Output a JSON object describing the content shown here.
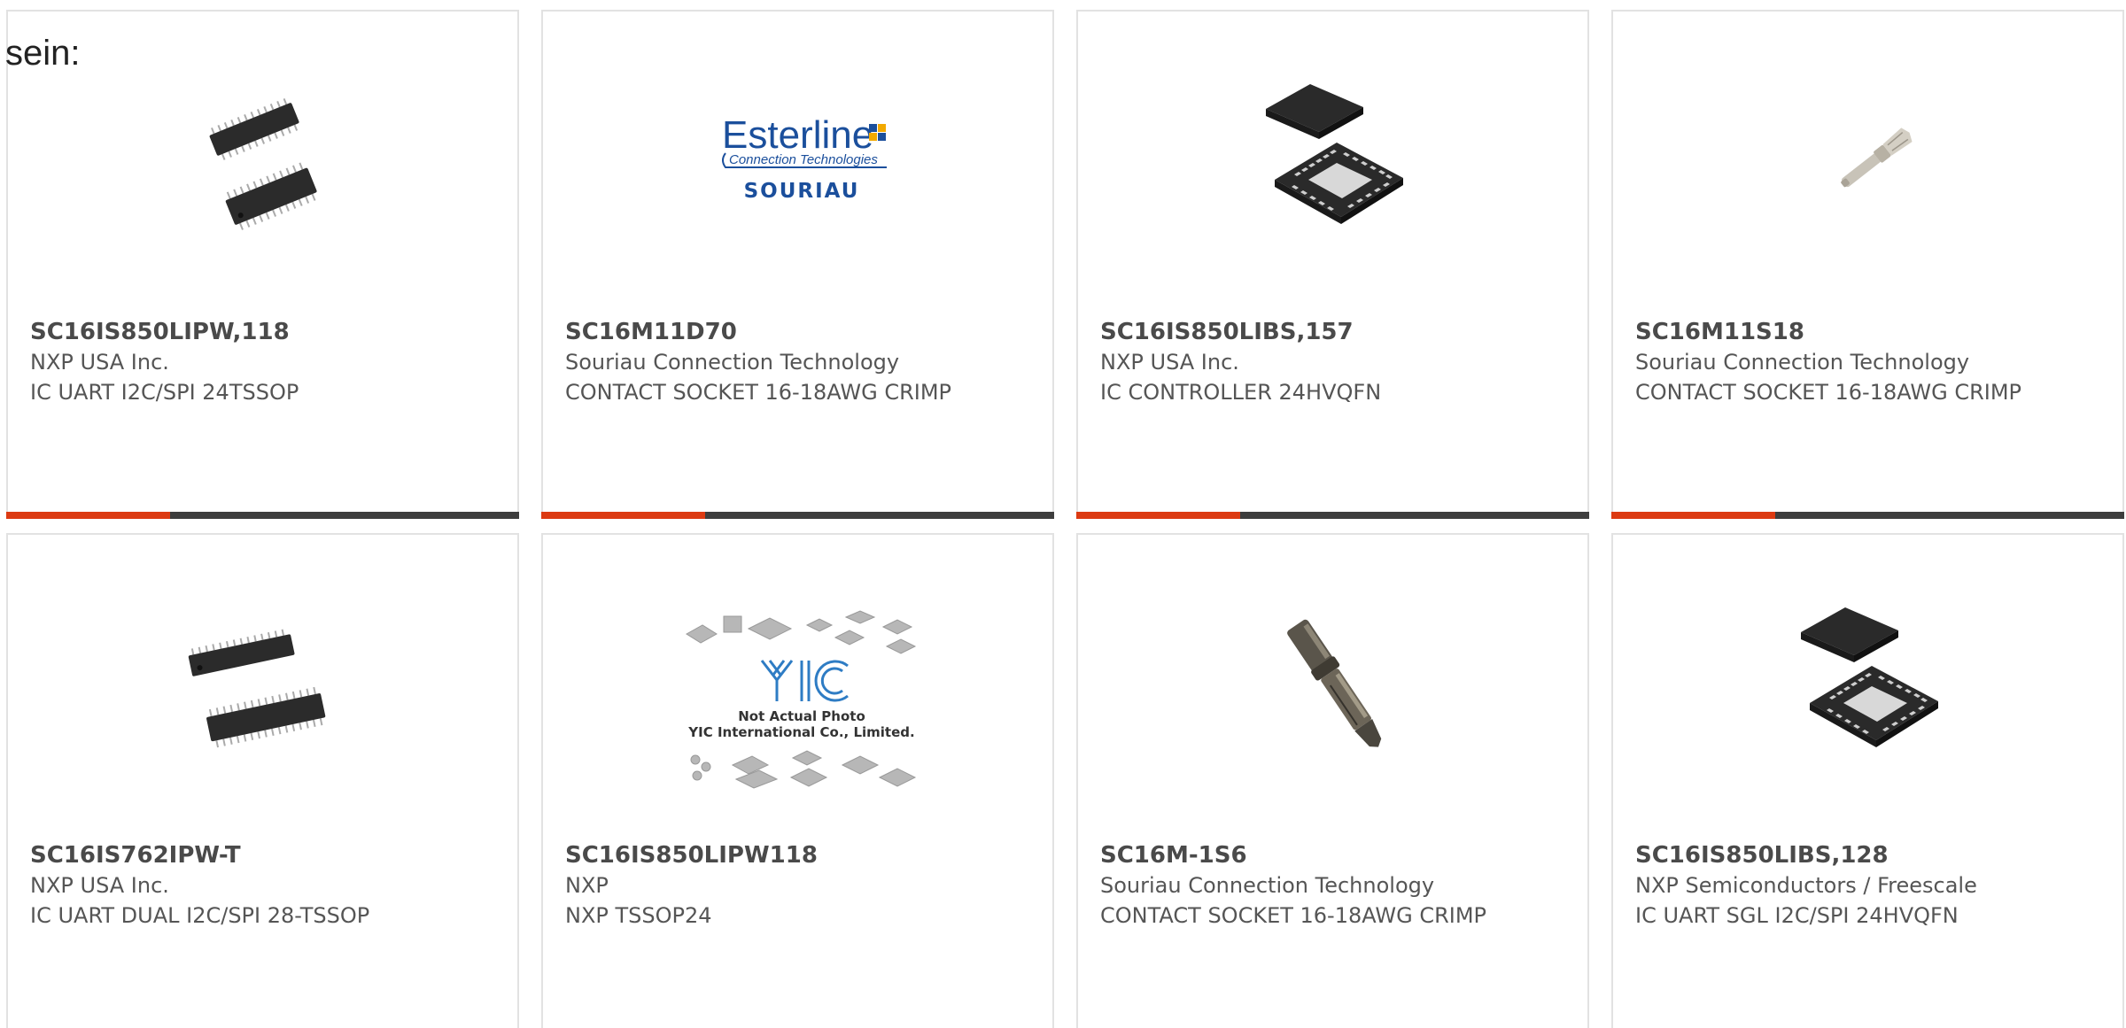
{
  "intro": {
    "text": "sein:"
  },
  "colors": {
    "accent": "#dc3a12",
    "bar_track": "#3d3d3d",
    "card_border": "#e2e2e2",
    "text_primary": "#4a4a4a",
    "text_secondary": "#555555"
  },
  "products": [
    {
      "part_number": "SC16IS850LIPW,118",
      "manufacturer": "NXP USA Inc.",
      "description": "IC UART I2C/SPI 24TSSOP",
      "image": "tssop-chip-image",
      "bar_fill_percent": 32
    },
    {
      "part_number": "SC16M11D70",
      "manufacturer": "Souriau Connection Technology",
      "description": "CONTACT SOCKET 16-18AWG CRIMP",
      "image": "esterline-souriau-logo",
      "logo_text": {
        "line1": "Esterline",
        "line2": "Connection Technologies",
        "line3": "SOURIAU"
      },
      "bar_fill_percent": 32
    },
    {
      "part_number": "SC16IS850LIBS,157",
      "manufacturer": "NXP USA Inc.",
      "description": "IC CONTROLLER 24HVQFN",
      "image": "hvqfn-chip-image",
      "bar_fill_percent": 32
    },
    {
      "part_number": "SC16M11S18",
      "manufacturer": "Souriau Connection Technology",
      "description": "CONTACT SOCKET 16-18AWG CRIMP",
      "image": "crimp-contact-image",
      "bar_fill_percent": 32
    },
    {
      "part_number": "SC16IS762IPW-T",
      "manufacturer": "NXP USA Inc.",
      "description": "IC UART DUAL I2C/SPI 28-TSSOP",
      "image": "tssop-chip-image"
    },
    {
      "part_number": "SC16IS850LIPW118",
      "manufacturer": "NXP",
      "description": "NXP TSSOP24",
      "image": "yic-placeholder-image",
      "placeholder_text": {
        "line1": "Not Actual Photo",
        "line2": "YIC International Co., Limited."
      }
    },
    {
      "part_number": "SC16M-1S6",
      "manufacturer": "Souriau Connection Technology",
      "description": "CONTACT SOCKET 16-18AWG CRIMP",
      "image": "socket-contact-image"
    },
    {
      "part_number": "SC16IS850LIBS,128",
      "manufacturer": "NXP Semiconductors / Freescale",
      "description": "IC UART SGL I2C/SPI 24HVQFN",
      "image": "hvqfn-chip-image"
    }
  ]
}
